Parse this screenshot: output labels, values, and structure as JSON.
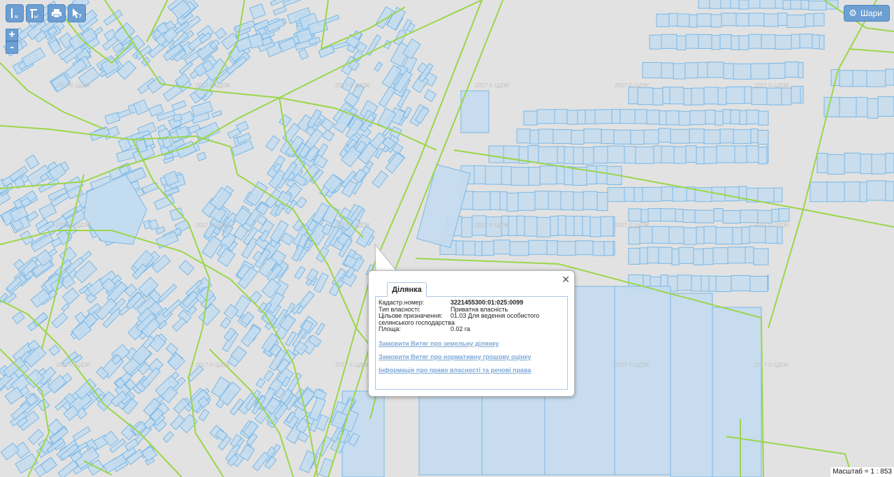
{
  "toolbar": {
    "measure_length_icon": "ruler-length-icon",
    "measure_area_icon": "ruler-area-icon",
    "print_icon": "print-icon",
    "identify_icon": "cursor-help-icon",
    "measure_length_sub": "м",
    "measure_area_sub": "м²"
  },
  "zoom": {
    "in_label": "+",
    "out_label": "-"
  },
  "layers_button": {
    "label": "Шари",
    "icon": "gear-icon"
  },
  "popup": {
    "tab_label": "Ділянка",
    "close_label": "✕",
    "fields": [
      {
        "key": "Кадастр.номер:",
        "value": "3221455300:01:025:0099",
        "bold": true
      },
      {
        "key": "Тип власності:",
        "value": "Приватна власність"
      },
      {
        "key": "Цільове призначення:",
        "value": "01.03 Для ведення особистого селянського господарства"
      },
      {
        "key": "Площа:",
        "value": "0.02 га"
      }
    ],
    "links": [
      "Замовити Витяг про земельну ділянку",
      "Замовити Витяг про нормативну грошову оцінку",
      "Інформація про право власності та речові права"
    ]
  },
  "map": {
    "watermark": "2017 © ЦДЗК",
    "colors": {
      "background": "#e2e2e2",
      "parcel_fill": "#c4dcef",
      "parcel_stroke": "#7ab8e6",
      "boundary": "#9ad64a"
    }
  },
  "scale_label": "Масштаб = 1 : 853"
}
